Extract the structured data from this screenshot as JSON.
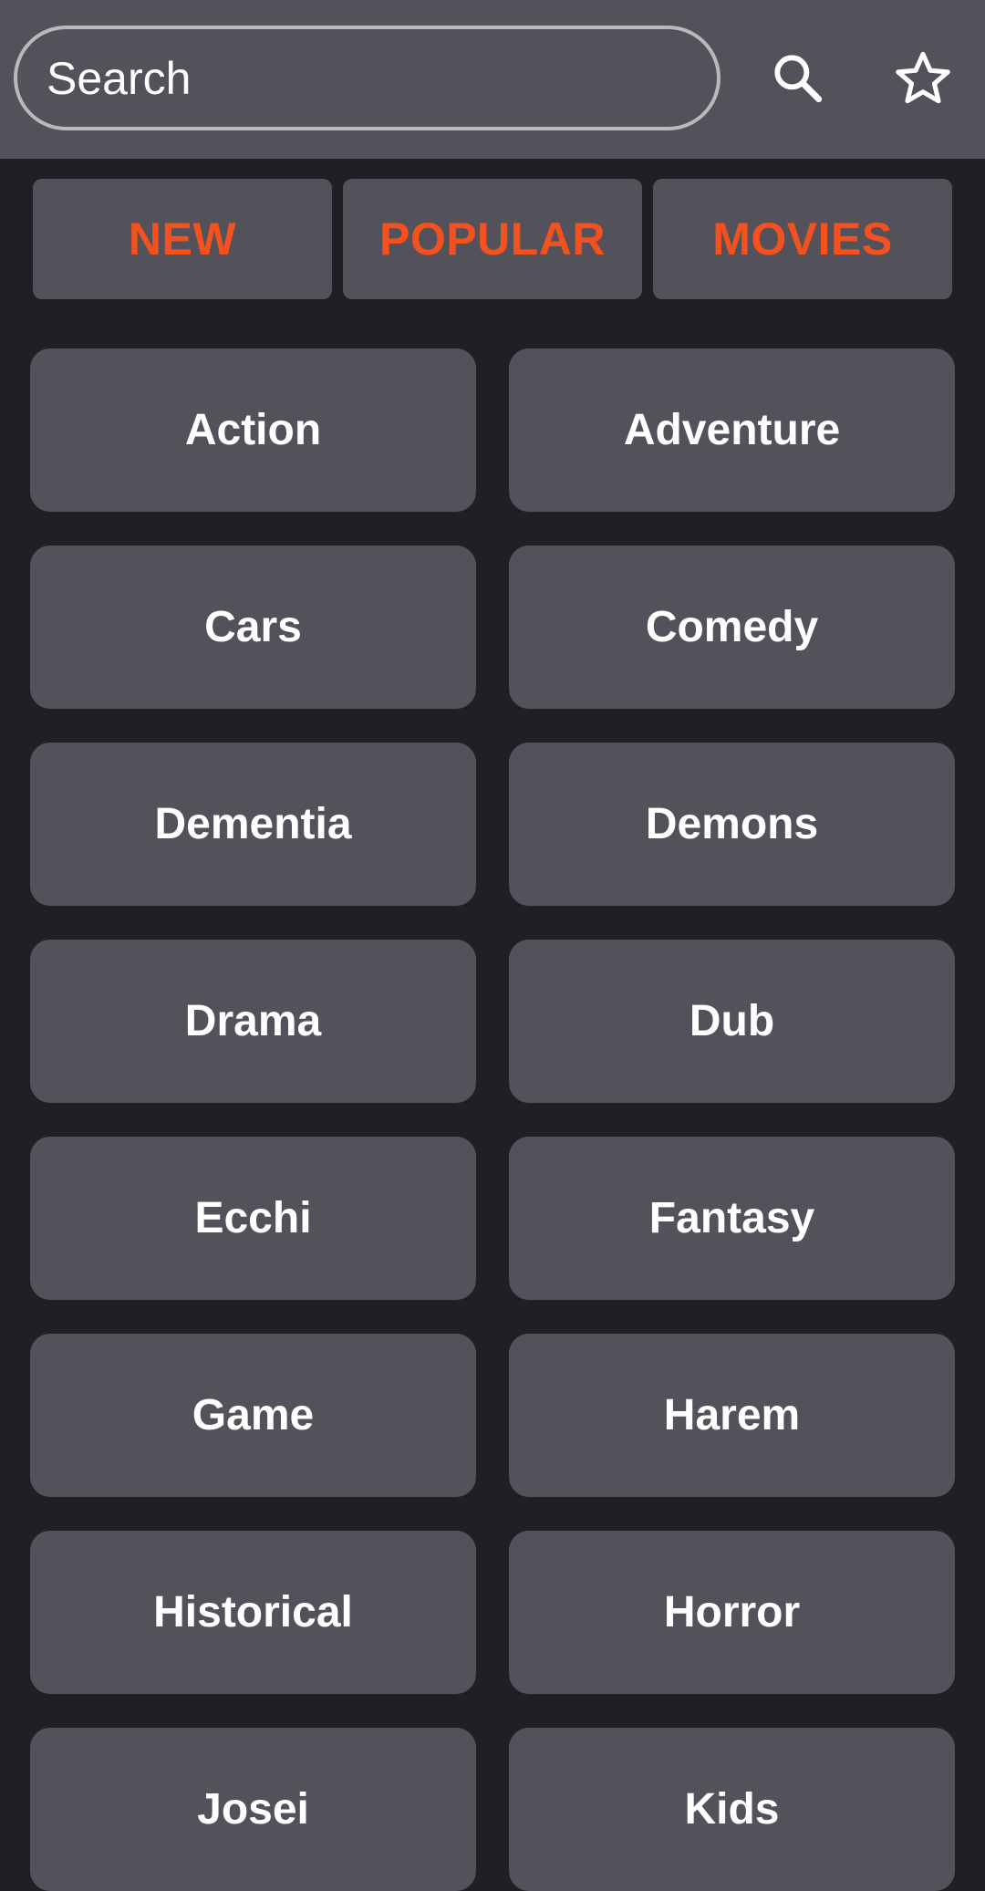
{
  "search": {
    "placeholder": "Search"
  },
  "toolbar": {
    "search_icon": "search-icon",
    "favorites_icon": "star-outline-icon"
  },
  "tabs": [
    {
      "label": "NEW"
    },
    {
      "label": "POPULAR"
    },
    {
      "label": "MOVIES"
    }
  ],
  "genres": [
    "Action",
    "Adventure",
    "Cars",
    "Comedy",
    "Dementia",
    "Demons",
    "Drama",
    "Dub",
    "Ecchi",
    "Fantasy",
    "Game",
    "Harem",
    "Historical",
    "Horror",
    "Josei",
    "Kids"
  ],
  "colors": {
    "background": "#201f26",
    "surface": "#53525a",
    "accent": "#f4511e",
    "text": "#ffffff"
  }
}
